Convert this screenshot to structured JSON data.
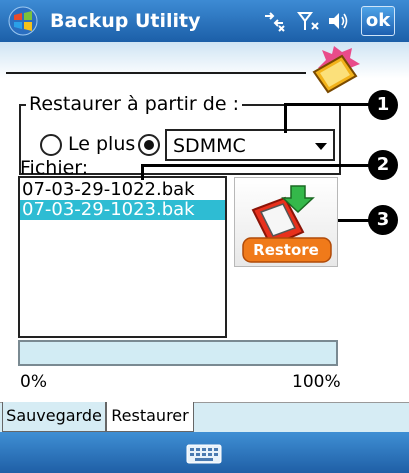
{
  "titlebar": {
    "title": "Backup Utility",
    "ok_label": "ok",
    "status_icons": [
      "connectivity-icon",
      "signal-icon",
      "speaker-icon"
    ]
  },
  "source_group": {
    "legend": "Restaurer à partir de :",
    "option_1_label": "Le plus",
    "option_1_selected": false,
    "option_2_selected": true,
    "storage_value": "SDMMC"
  },
  "file_list": {
    "label": "Fichier:",
    "items": [
      {
        "name": "07-03-29-1022.bak",
        "selected": false
      },
      {
        "name": "07-03-29-1023.bak",
        "selected": true
      }
    ]
  },
  "restore_button": {
    "label": "Restore",
    "icon": "pda-restore-icon"
  },
  "progress": {
    "value": 0,
    "min_label": "0%",
    "max_label": "100%"
  },
  "tabs": [
    {
      "label": "Sauvegarde",
      "active": false
    },
    {
      "label": "Restaurer",
      "active": true
    }
  ],
  "callouts": [
    "1",
    "2",
    "3"
  ],
  "colors": {
    "titlebar": "#1c5fa8",
    "selection": "#2ebcd3",
    "restore_red": "#e8301c"
  }
}
